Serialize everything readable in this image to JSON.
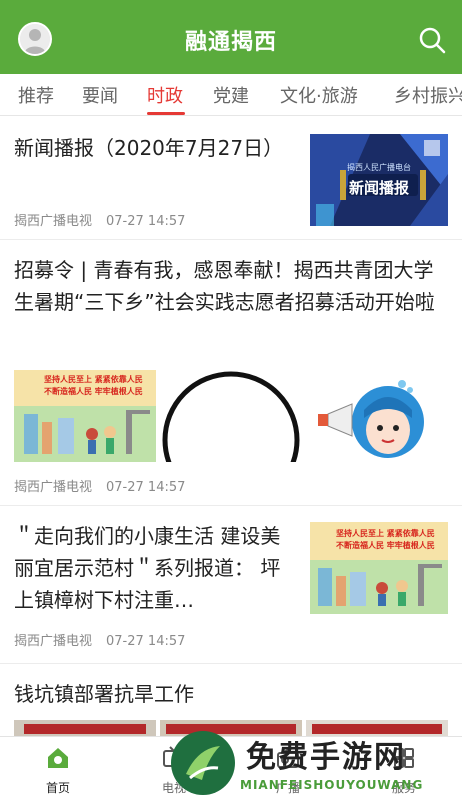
{
  "header": {
    "app_title": "融通揭西"
  },
  "tabs": [
    {
      "label": "推荐"
    },
    {
      "label": "要闻"
    },
    {
      "label": "时政",
      "active": true
    },
    {
      "label": "党建"
    },
    {
      "label": "文化·旅游"
    },
    {
      "label": "乡村振兴"
    }
  ],
  "feed": [
    {
      "title": "新闻播报（2020年7月27日）",
      "source": "揭西广播电视",
      "time": "07-27 14:57",
      "thumb": {
        "caption_small": "揭西人民广播电台",
        "caption_big": "新闻播报"
      }
    },
    {
      "title": "招募令 | 青春有我，感恩奉献！揭西共青团大学生暑期“三下乡”社会实践志愿者招募活动开始啦",
      "source": "揭西广播电视",
      "time": "07-27 14:57",
      "banner": {
        "line1": "坚持人民至上  紧紧依靠人民",
        "line2": "不断造福人民  牢牢植根人民"
      }
    },
    {
      "title": "＂走向我们的小康生活 建设美丽宜居示范村＂系列报道： 坪上镇樟树下村注重…",
      "source": "揭西广播电视",
      "time": "07-27 14:57",
      "banner": {
        "line1": "坚持人民至上  紧紧依靠人民",
        "line2": "不断造福人民  牢牢植根人民"
      }
    },
    {
      "title": "钱坑镇部署抗旱工作"
    }
  ],
  "bottom_nav": [
    {
      "label": "首页",
      "icon": "home-icon",
      "active": true
    },
    {
      "label": "电视",
      "icon": "tv-icon"
    },
    {
      "label": "广播",
      "icon": "radio-icon"
    },
    {
      "label": "服务",
      "icon": "service-icon"
    }
  ],
  "watermark": {
    "text": "免费手游网",
    "sub": "MIANFEISHOUYOUWANG"
  },
  "colors": {
    "brand_green": "#5aab3c",
    "active_tab": "#e53935"
  }
}
